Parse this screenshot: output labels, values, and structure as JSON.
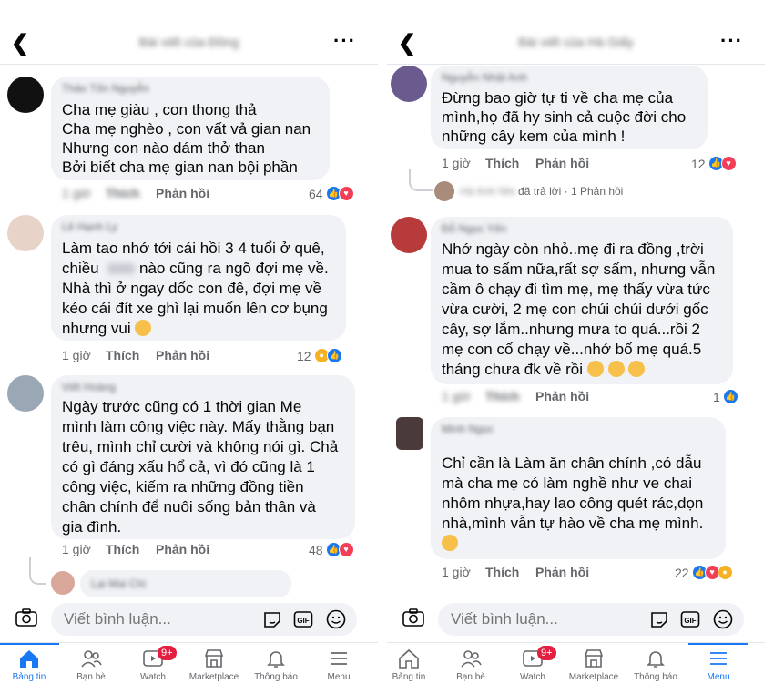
{
  "panel1": {
    "title": "Bài viết của Đồng",
    "comments": [
      {
        "name": "Thảo Tốn Nguyễn",
        "lines": [
          "Cha mẹ giàu , con thong thả",
          "Cha mẹ nghèo , con vất vả gian nan",
          "Nhưng con nào dám thở than",
          "Bởi biết cha mẹ gian nan bội phần"
        ],
        "time": "1 giờ",
        "like": "Thích",
        "reply": "Phản hồi",
        "count": "64"
      },
      {
        "name": "Lê Hạnh Ly",
        "lines": [
          "Làm tao nhớ tới cái hồi 3 4 tuổi ở quê,",
          "chiều",
          "nào cũng ra ngõ đợi mẹ về.",
          "Nhà thì ở ngay dốc con đê, đợi mẹ về",
          "kéo cái đít xe ghì lại muốn lên cơ bụng",
          "nhưng vui"
        ],
        "blurred_word": "chiều",
        "time": "1 giờ",
        "like": "Thích",
        "reply": "Phản hồi",
        "count": "12"
      },
      {
        "name": "Viết Hoàng",
        "lines": [
          "Ngày trước cũng có 1 thời gian Mẹ",
          "mình làm công việc này. Mấy thằng bạn",
          "trêu, mình chỉ cười và không nói gì. Chả",
          "có gì đáng xấu hổ cả, vì đó cũng là 1",
          "công việc, kiếm ra những đồng tiền",
          "chân chính để nuôi sống bản thân và",
          "gia đình."
        ],
        "time": "1 giờ",
        "like": "Thích",
        "reply": "Phản hồi",
        "count": "48"
      },
      {
        "name": "Lại Mai Chi"
      }
    ]
  },
  "panel2": {
    "title": "Bài viết của Hà Giấy",
    "comments": [
      {
        "name": "Nguyễn Nhật Anh",
        "lines": [
          "Đừng bao giờ tự ti về cha mẹ của",
          "mình,họ đã hy sinh cả cuộc đời cho",
          "những cây kem của mình !"
        ],
        "time": "1 giờ",
        "like": "Thích",
        "reply": "Phản hồi",
        "count": "12",
        "reply_name": "Hà Anh Nhi",
        "reply_text": "đã trả lời",
        "reply_count": "· 1 Phản hồi"
      },
      {
        "name": "Đỗ Ngọc Yến",
        "lines": [
          "Nhớ ngày còn nhỏ..mẹ đi ra đồng ,trời",
          "mua to sấm nữa,rất sợ sấm, nhưng vẫn",
          "cầm ô chạy đi tìm mẹ, mẹ thấy vừa tức",
          "vừa cười, 2 mẹ con chúi chúi dưới gốc",
          "cây, sợ lắm..nhưng mưa to quá...rồi 2",
          "mẹ con cố chạy về...nhớ bố mẹ quá.5",
          "tháng chưa đk về rồi"
        ],
        "time": "1 giờ",
        "like": "Thích",
        "reply": "Phản hồi",
        "count": "1"
      },
      {
        "name": "Minh Ngọc",
        "lines": [
          "Chỉ cần là Làm ăn chân chính ,có dẫu",
          "mà cha mẹ  có làm nghề như ve chai",
          "nhôm nhựa,hay lao công quét rác,dọn",
          "nhà,mình vẫn tự hào về cha mẹ mình."
        ],
        "time": "1 giờ",
        "like": "Thích",
        "reply": "Phản hồi",
        "count": "22"
      }
    ]
  },
  "composer": {
    "placeholder": "Viết bình luận..."
  },
  "tabs": [
    {
      "label": "Bảng tin",
      "icon": "home-icon"
    },
    {
      "label": "Bạn bè",
      "icon": "friends-icon"
    },
    {
      "label": "Watch",
      "icon": "watch-icon",
      "badge": "9+"
    },
    {
      "label": "Marketplace",
      "icon": "marketplace-icon"
    },
    {
      "label": "Thông báo",
      "icon": "bell-icon"
    },
    {
      "label": "Menu",
      "icon": "menu-icon"
    }
  ],
  "colors": {
    "accent": "#1877f2",
    "bubble": "#f0f2f5",
    "muted": "#65676b",
    "badge": "#e41e3f"
  }
}
